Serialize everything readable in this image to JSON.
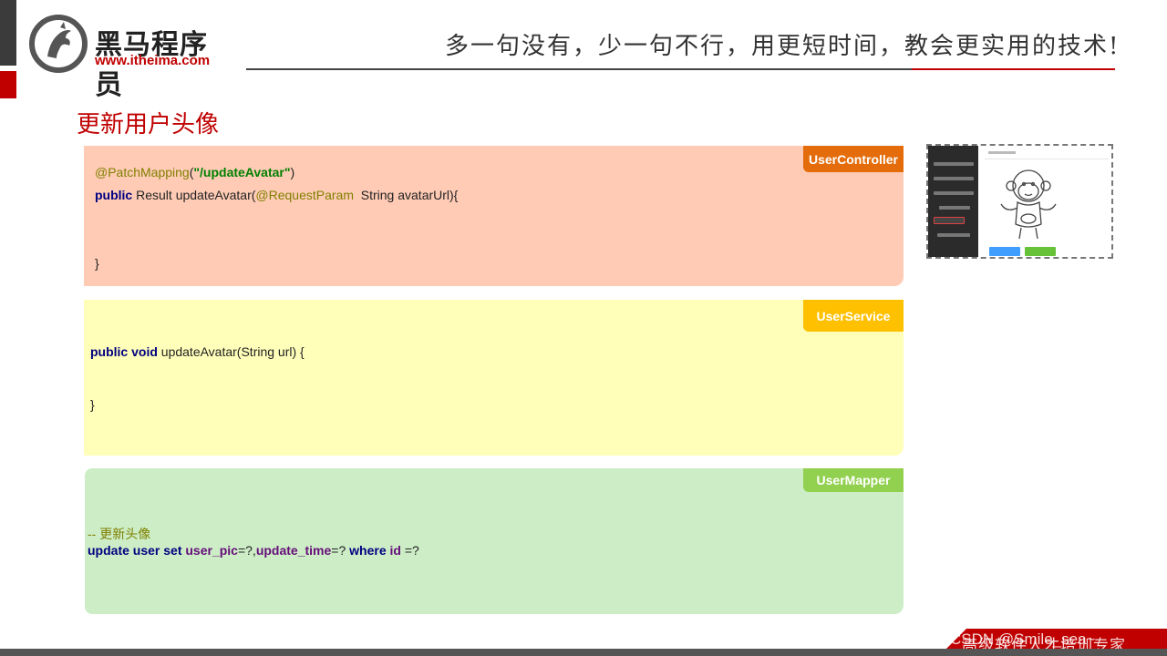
{
  "brand": {
    "name": "黑马程序员",
    "url": "www.itheima.com",
    "logo_icon": "horse-head-icon"
  },
  "header": {
    "slogan": "多一句没有，少一句不行，用更短时间，教会更实用的技术!"
  },
  "title": "更新用户头像",
  "panels": {
    "controller": {
      "tag": "UserController",
      "line1_anno": "@PatchMapping",
      "line1_paren_open": "(",
      "line1_str": "\"/updateAvatar\"",
      "line1_paren_close": ")",
      "line2_kw": "public",
      "line2_a": " Result updateAvatar(",
      "line2_anno": "@RequestParam",
      "line2_b": "  String avatarUrl){",
      "close": "}"
    },
    "service": {
      "tag": "UserService",
      "line1_kw": "public void",
      "line1_rest": " updateAvatar(String url) {",
      "close": "}"
    },
    "mapper": {
      "tag": "UserMapper",
      "comment": "-- 更新头像",
      "sql_kw1": "update user set ",
      "sql_f1": "user_pic",
      "sql_p1": "=?,",
      "sql_f2": "update_time",
      "sql_p2": "=? ",
      "sql_kw2": "where ",
      "sql_f3": "id ",
      "sql_p3": "=?"
    }
  },
  "thumbnail": {
    "icon": "avatar-upload-screenshot-icon"
  },
  "footer": {
    "text": "高级软件人才培训专家",
    "watermark": "CSDN @Smile_sea~"
  },
  "colors": {
    "accent_red": "#c00000",
    "controller_bg": "#ffcbb5",
    "service_bg": "#ffffba",
    "mapper_bg": "#ccedc6",
    "controller_tag": "#e46c0a",
    "service_tag": "#ffc000",
    "mapper_tag": "#92d050"
  }
}
